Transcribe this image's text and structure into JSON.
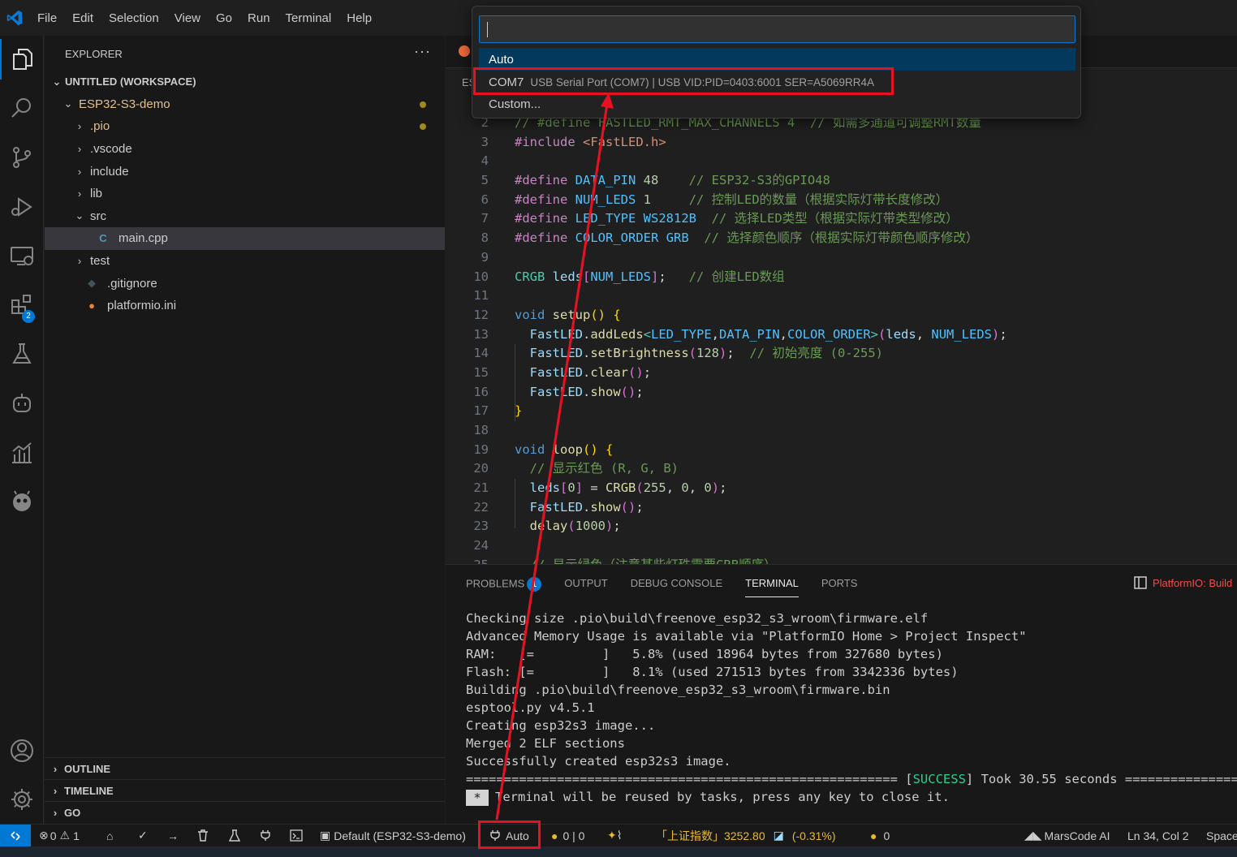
{
  "menu": [
    "File",
    "Edit",
    "Selection",
    "View",
    "Go",
    "Run",
    "Terminal",
    "Help"
  ],
  "activity": {
    "extensions_badge": "2"
  },
  "explorer": {
    "title": "EXPLORER",
    "more": "···",
    "workspace": "UNTITLED (WORKSPACE)",
    "tree": [
      {
        "label": "ESP32-S3-demo",
        "depth": 1,
        "kind": "open",
        "color": "#e2c08d",
        "mod": true
      },
      {
        "label": ".pio",
        "depth": 2,
        "kind": "closed",
        "color": "#e2c08d",
        "mod": true
      },
      {
        "label": ".vscode",
        "depth": 2,
        "kind": "closed"
      },
      {
        "label": "include",
        "depth": 2,
        "kind": "closed"
      },
      {
        "label": "lib",
        "depth": 2,
        "kind": "closed"
      },
      {
        "label": "src",
        "depth": 2,
        "kind": "open"
      },
      {
        "label": "main.cpp",
        "depth": 3,
        "kind": "cpp",
        "selected": true
      },
      {
        "label": "test",
        "depth": 2,
        "kind": "closed"
      },
      {
        "label": ".gitignore",
        "depth": 2,
        "kind": "git"
      },
      {
        "label": "platformio.ini",
        "depth": 2,
        "kind": "pio"
      }
    ],
    "sections": [
      "OUTLINE",
      "TIMELINE",
      "GO"
    ]
  },
  "tab_fragment": "ES",
  "palette": {
    "input": "",
    "items": [
      {
        "label": "Auto",
        "desc": ""
      },
      {
        "label": "COM7",
        "desc": "USB Serial Port (COM7) | USB VID:PID=0403:6001 SER=A5069RR4A"
      },
      {
        "label": "Custom...",
        "desc": ""
      }
    ]
  },
  "code": [
    {
      "n": "2",
      "html": "<span class=\"c\">// #define FASTLED_RMT_MAX_CHANNELS 4  // 如需多通道可调整RMT数量</span>"
    },
    {
      "n": "3",
      "html": "<span class=\"k\">#include</span> <span class=\"s\">&lt;FastLED.h&gt;</span>"
    },
    {
      "n": "4",
      "html": ""
    },
    {
      "n": "5",
      "html": "<span class=\"k\">#define</span> <span class=\"m\">DATA_PIN</span> <span class=\"n\">48</span>    <span class=\"c\">// ESP32-S3的GPIO48</span>"
    },
    {
      "n": "6",
      "html": "<span class=\"k\">#define</span> <span class=\"m\">NUM_LEDS</span> <span class=\"n\">1</span>     <span class=\"c\">// 控制LED的数量（根据实际灯带长度修改）</span>"
    },
    {
      "n": "7",
      "html": "<span class=\"k\">#define</span> <span class=\"m\">LED_TYPE</span> <span class=\"m\">WS2812B</span>  <span class=\"c\">// 选择LED类型（根据实际灯带类型修改）</span>"
    },
    {
      "n": "8",
      "html": "<span class=\"k\">#define</span> <span class=\"m\">COLOR_ORDER</span> <span class=\"m\">GRB</span>  <span class=\"c\">// 选择颜色顺序（根据实际灯带颜色顺序修改）</span>"
    },
    {
      "n": "9",
      "html": ""
    },
    {
      "n": "10",
      "html": "<span class=\"t\">CRGB</span> <span class=\"var\">leds</span><span class=\"bp\">[</span><span class=\"m\">NUM_LEDS</span><span class=\"bp\">]</span>;   <span class=\"c\">// 创建LED数组</span>"
    },
    {
      "n": "11",
      "html": ""
    },
    {
      "n": "12",
      "html": "<span class=\"v\">void</span> <span class=\"f\">setup</span><span class=\"br\">()</span> <span class=\"br\">{</span>"
    },
    {
      "n": "13",
      "html": "  <span class=\"var\">FastLED</span>.<span class=\"f\">addLeds</span><span class=\"t\">&lt;</span><span class=\"m\">LED_TYPE</span>,<span class=\"m\">DATA_PIN</span>,<span class=\"m\">COLOR_ORDER</span><span class=\"t\">&gt;</span><span class=\"bp\">(</span><span class=\"var\">leds</span>, <span class=\"m\">NUM_LEDS</span><span class=\"bp\">)</span>;"
    },
    {
      "n": "14",
      "html": "  <span class=\"var\">FastLED</span>.<span class=\"f\">setBrightness</span><span class=\"bp\">(</span><span class=\"n\">128</span><span class=\"bp\">)</span>;  <span class=\"c\">// 初始亮度 (0-255)</span>"
    },
    {
      "n": "15",
      "html": "  <span class=\"var\">FastLED</span>.<span class=\"f\">clear</span><span class=\"bp\">()</span>;"
    },
    {
      "n": "16",
      "html": "  <span class=\"var\">FastLED</span>.<span class=\"f\">show</span><span class=\"bp\">()</span>;"
    },
    {
      "n": "17",
      "html": "<span class=\"br\">}</span>"
    },
    {
      "n": "18",
      "html": ""
    },
    {
      "n": "19",
      "html": "<span class=\"v\">void</span> <span class=\"f\">loop</span><span class=\"br\">()</span> <span class=\"br\">{</span>"
    },
    {
      "n": "20",
      "html": "  <span class=\"c\">// 显示红色 (R, G, B)</span>"
    },
    {
      "n": "21",
      "html": "  <span class=\"var\">leds</span><span class=\"bp\">[</span><span class=\"n\">0</span><span class=\"bp\">]</span> = <span class=\"f\">CRGB</span><span class=\"bp\">(</span><span class=\"n\">255</span>, <span class=\"n\">0</span>, <span class=\"n\">0</span><span class=\"bp\">)</span>;"
    },
    {
      "n": "22",
      "html": "  <span class=\"var\">FastLED</span>.<span class=\"f\">show</span><span class=\"bp\">()</span>;"
    },
    {
      "n": "23",
      "html": "  <span class=\"f\">delay</span><span class=\"bp\">(</span><span class=\"n\">1000</span><span class=\"bp\">)</span>;"
    },
    {
      "n": "24",
      "html": ""
    },
    {
      "n": "25",
      "html": "  <span class=\"c\">// 显示绿色（注意某些灯珠需要GRB顺序）</span>"
    }
  ],
  "panel": {
    "tabs": [
      "PROBLEMS",
      "OUTPUT",
      "DEBUG CONSOLE",
      "TERMINAL",
      "PORTS"
    ],
    "problems_count": "1",
    "task": "PlatformIO: Build"
  },
  "terminal": [
    "Checking size .pio\\build\\freenove_esp32_s3_wroom\\firmware.elf",
    "Advanced Memory Usage is available via \"PlatformIO Home > Project Inspect\"",
    "RAM:   [=         ]   5.8% (used 18964 bytes from 327680 bytes)",
    "Flash: [=         ]   8.1% (used 271513 bytes from 3342336 bytes)",
    "Building .pio\\build\\freenove_esp32_s3_wroom\\firmware.bin",
    "esptool.py v4.5.1",
    "Creating esp32s3 image...",
    "Merged 2 ELF sections",
    "Successfully created esp32s3 image."
  ],
  "terminal_success": {
    "pre": "========================================================= [",
    "word": "SUCCESS",
    "post": "] Took 30.55 seconds ================"
  },
  "terminal_reuse": {
    "star": "*",
    "text": "Terminal will be reused by tasks, press any key to close it."
  },
  "status": {
    "errors": "0",
    "warnings": "1",
    "env": "Default (ESP32-S3-demo)",
    "port": "Auto",
    "coins": "0 | 0",
    "stock": "「上证指数」3252.80",
    "stock_change": "(-0.31%)",
    "coin2": "0",
    "ai": "MarsCode AI",
    "cursor": "Ln 34, Col 2",
    "spaces": "Space"
  }
}
